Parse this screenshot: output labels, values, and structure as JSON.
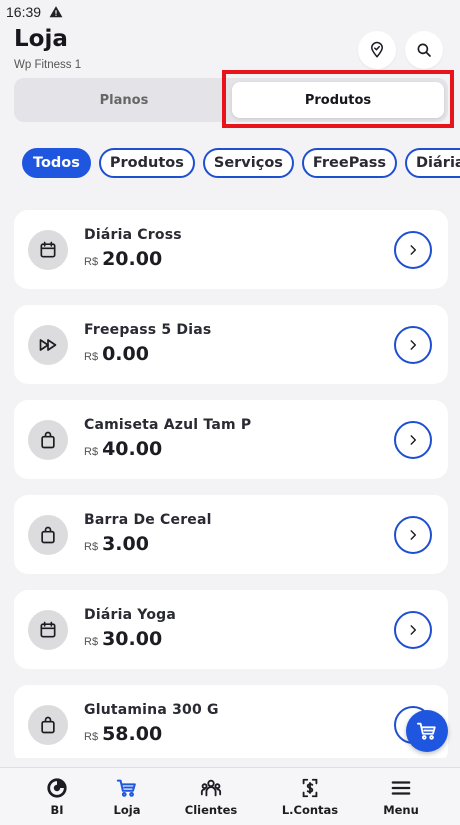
{
  "status_bar": {
    "time": "16:39"
  },
  "header": {
    "title": "Loja",
    "subtitle": "Wp Fitness 1"
  },
  "segment": {
    "planos": "Planos",
    "produtos": "Produtos"
  },
  "chips": [
    "Todos",
    "Produtos",
    "Serviços",
    "FreePass",
    "Diária"
  ],
  "products": [
    {
      "name": "Diária Cross",
      "currency": "R$",
      "price": "20.00",
      "icon": "calendar-icon"
    },
    {
      "name": "Freepass 5 Dias",
      "currency": "R$",
      "price": "0.00",
      "icon": "fast-forward-icon"
    },
    {
      "name": "Camiseta Azul Tam P",
      "currency": "R$",
      "price": "40.00",
      "icon": "shopping-bag-icon"
    },
    {
      "name": "Barra De Cereal",
      "currency": "R$",
      "price": "3.00",
      "icon": "shopping-bag-icon"
    },
    {
      "name": "Diária Yoga",
      "currency": "R$",
      "price": "30.00",
      "icon": "calendar-icon"
    },
    {
      "name": "Glutamina 300 G",
      "currency": "R$",
      "price": "58.00",
      "icon": "shopping-bag-icon"
    }
  ],
  "bottom_nav": [
    {
      "label": "BI",
      "icon": "bi-icon"
    },
    {
      "label": "Loja",
      "icon": "cart-icon"
    },
    {
      "label": "Clientes",
      "icon": "users-icon"
    },
    {
      "label": "L.Contas",
      "icon": "receipt-icon"
    },
    {
      "label": "Menu",
      "icon": "menu-icon"
    }
  ],
  "colors": {
    "accent": "#1f56e0",
    "highlight": "#e8141c",
    "background": "#f3f3f5"
  }
}
